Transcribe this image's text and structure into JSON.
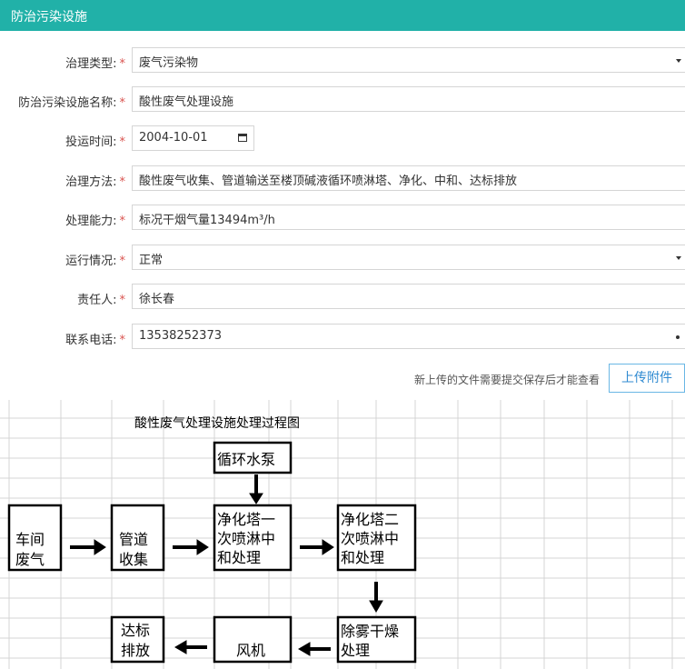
{
  "dialog": {
    "title": "防治污染设施"
  },
  "form": {
    "required_mark": "*",
    "governance_type": {
      "label": "治理类型:",
      "value": "废气污染物"
    },
    "facility_name": {
      "label": "防治污染设施名称:",
      "value": "酸性废气处理设施"
    },
    "commission_date": {
      "label": "投运时间:",
      "value": "2004-10-01"
    },
    "governance_method": {
      "label": "治理方法:",
      "value": "酸性废气收集、管道输送至楼顶碱液循环喷淋塔、净化、中和、达标排放"
    },
    "capacity": {
      "label": "处理能力:",
      "value": "标况干烟气量13494m³/h"
    },
    "operation_status": {
      "label": "运行情况:",
      "value": "正常"
    },
    "responsible_person": {
      "label": "责任人:",
      "value": "徐长春"
    },
    "contact_phone": {
      "label": "联系电话:",
      "value": "13538252373"
    }
  },
  "upload": {
    "note": "新上传的文件需要提交保存后才能查看",
    "button_label": "上传附件"
  },
  "flowchart": {
    "title": "酸性废气处理设施处理过程图",
    "nodes": {
      "pump": [
        "循环水泵"
      ],
      "workshop_gas": [
        "车间",
        "废气"
      ],
      "pipeline": [
        "管道",
        "收集"
      ],
      "tower1": [
        "净化塔一",
        "次喷淋中",
        "和处理"
      ],
      "tower2": [
        "净化塔二",
        "次喷淋中",
        "和处理"
      ],
      "demist": [
        "除雾干燥",
        "处理"
      ],
      "fan": [
        "风机"
      ],
      "discharge": [
        "达标",
        "排放"
      ]
    }
  }
}
